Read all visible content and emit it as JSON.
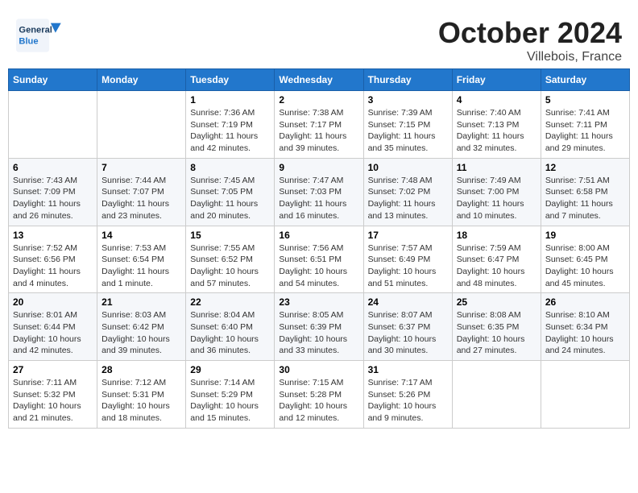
{
  "header": {
    "logo_general": "General",
    "logo_blue": "Blue",
    "month_title": "October 2024",
    "location": "Villebois, France"
  },
  "weekdays": [
    "Sunday",
    "Monday",
    "Tuesday",
    "Wednesday",
    "Thursday",
    "Friday",
    "Saturday"
  ],
  "weeks": [
    [
      {
        "day": "",
        "info": ""
      },
      {
        "day": "",
        "info": ""
      },
      {
        "day": "1",
        "info": "Sunrise: 7:36 AM\nSunset: 7:19 PM\nDaylight: 11 hours and 42 minutes."
      },
      {
        "day": "2",
        "info": "Sunrise: 7:38 AM\nSunset: 7:17 PM\nDaylight: 11 hours and 39 minutes."
      },
      {
        "day": "3",
        "info": "Sunrise: 7:39 AM\nSunset: 7:15 PM\nDaylight: 11 hours and 35 minutes."
      },
      {
        "day": "4",
        "info": "Sunrise: 7:40 AM\nSunset: 7:13 PM\nDaylight: 11 hours and 32 minutes."
      },
      {
        "day": "5",
        "info": "Sunrise: 7:41 AM\nSunset: 7:11 PM\nDaylight: 11 hours and 29 minutes."
      }
    ],
    [
      {
        "day": "6",
        "info": "Sunrise: 7:43 AM\nSunset: 7:09 PM\nDaylight: 11 hours and 26 minutes."
      },
      {
        "day": "7",
        "info": "Sunrise: 7:44 AM\nSunset: 7:07 PM\nDaylight: 11 hours and 23 minutes."
      },
      {
        "day": "8",
        "info": "Sunrise: 7:45 AM\nSunset: 7:05 PM\nDaylight: 11 hours and 20 minutes."
      },
      {
        "day": "9",
        "info": "Sunrise: 7:47 AM\nSunset: 7:03 PM\nDaylight: 11 hours and 16 minutes."
      },
      {
        "day": "10",
        "info": "Sunrise: 7:48 AM\nSunset: 7:02 PM\nDaylight: 11 hours and 13 minutes."
      },
      {
        "day": "11",
        "info": "Sunrise: 7:49 AM\nSunset: 7:00 PM\nDaylight: 11 hours and 10 minutes."
      },
      {
        "day": "12",
        "info": "Sunrise: 7:51 AM\nSunset: 6:58 PM\nDaylight: 11 hours and 7 minutes."
      }
    ],
    [
      {
        "day": "13",
        "info": "Sunrise: 7:52 AM\nSunset: 6:56 PM\nDaylight: 11 hours and 4 minutes."
      },
      {
        "day": "14",
        "info": "Sunrise: 7:53 AM\nSunset: 6:54 PM\nDaylight: 11 hours and 1 minute."
      },
      {
        "day": "15",
        "info": "Sunrise: 7:55 AM\nSunset: 6:52 PM\nDaylight: 10 hours and 57 minutes."
      },
      {
        "day": "16",
        "info": "Sunrise: 7:56 AM\nSunset: 6:51 PM\nDaylight: 10 hours and 54 minutes."
      },
      {
        "day": "17",
        "info": "Sunrise: 7:57 AM\nSunset: 6:49 PM\nDaylight: 10 hours and 51 minutes."
      },
      {
        "day": "18",
        "info": "Sunrise: 7:59 AM\nSunset: 6:47 PM\nDaylight: 10 hours and 48 minutes."
      },
      {
        "day": "19",
        "info": "Sunrise: 8:00 AM\nSunset: 6:45 PM\nDaylight: 10 hours and 45 minutes."
      }
    ],
    [
      {
        "day": "20",
        "info": "Sunrise: 8:01 AM\nSunset: 6:44 PM\nDaylight: 10 hours and 42 minutes."
      },
      {
        "day": "21",
        "info": "Sunrise: 8:03 AM\nSunset: 6:42 PM\nDaylight: 10 hours and 39 minutes."
      },
      {
        "day": "22",
        "info": "Sunrise: 8:04 AM\nSunset: 6:40 PM\nDaylight: 10 hours and 36 minutes."
      },
      {
        "day": "23",
        "info": "Sunrise: 8:05 AM\nSunset: 6:39 PM\nDaylight: 10 hours and 33 minutes."
      },
      {
        "day": "24",
        "info": "Sunrise: 8:07 AM\nSunset: 6:37 PM\nDaylight: 10 hours and 30 minutes."
      },
      {
        "day": "25",
        "info": "Sunrise: 8:08 AM\nSunset: 6:35 PM\nDaylight: 10 hours and 27 minutes."
      },
      {
        "day": "26",
        "info": "Sunrise: 8:10 AM\nSunset: 6:34 PM\nDaylight: 10 hours and 24 minutes."
      }
    ],
    [
      {
        "day": "27",
        "info": "Sunrise: 7:11 AM\nSunset: 5:32 PM\nDaylight: 10 hours and 21 minutes."
      },
      {
        "day": "28",
        "info": "Sunrise: 7:12 AM\nSunset: 5:31 PM\nDaylight: 10 hours and 18 minutes."
      },
      {
        "day": "29",
        "info": "Sunrise: 7:14 AM\nSunset: 5:29 PM\nDaylight: 10 hours and 15 minutes."
      },
      {
        "day": "30",
        "info": "Sunrise: 7:15 AM\nSunset: 5:28 PM\nDaylight: 10 hours and 12 minutes."
      },
      {
        "day": "31",
        "info": "Sunrise: 7:17 AM\nSunset: 5:26 PM\nDaylight: 10 hours and 9 minutes."
      },
      {
        "day": "",
        "info": ""
      },
      {
        "day": "",
        "info": ""
      }
    ]
  ]
}
